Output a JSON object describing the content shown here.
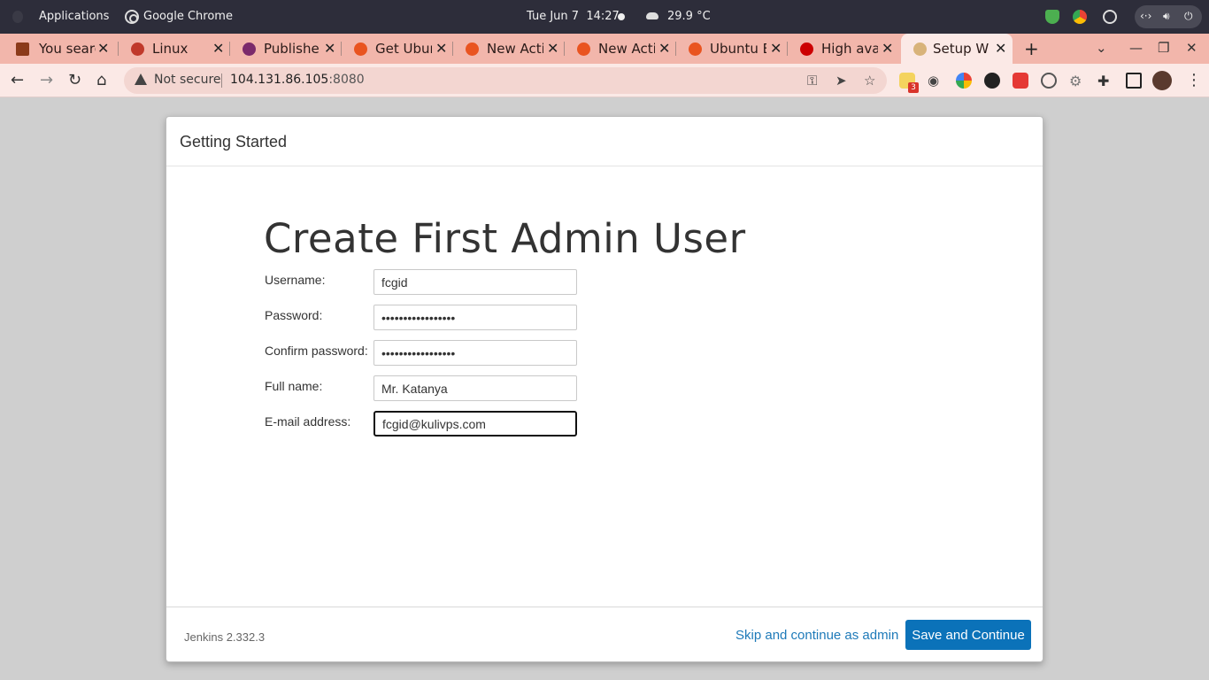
{
  "system_bar": {
    "applications": "Applications",
    "active_app": "Google Chrome",
    "date": "Tue Jun 7",
    "time": "14:27",
    "temperature": "29.9 °C"
  },
  "tabs": [
    {
      "title": "You searc",
      "favicon_color": "#8b3a1a"
    },
    {
      "title": "Linux",
      "favicon_color": "#c0392b"
    },
    {
      "title": "Publisher",
      "favicon_color": "#7b2a6b"
    },
    {
      "title": "Get Ubun",
      "favicon_color": "#e95420"
    },
    {
      "title": "New Acti",
      "favicon_color": "#e95420"
    },
    {
      "title": "New Acti",
      "favicon_color": "#e95420"
    },
    {
      "title": "Ubuntu E",
      "favicon_color": "#e95420"
    },
    {
      "title": "High ava",
      "favicon_color": "#cc0000"
    },
    {
      "title": "Setup Wi",
      "favicon_color": "#d8b37a",
      "active": true
    }
  ],
  "address_bar": {
    "security_label": "Not secure",
    "host": "104.131.86.105",
    "port": ":8080"
  },
  "extensions": {
    "badge_count": "3"
  },
  "dialog": {
    "header_title": "Getting Started",
    "heading": "Create First Admin User",
    "fields": {
      "username": {
        "label": "Username:",
        "value": "fcgid"
      },
      "password": {
        "label": "Password:",
        "value": "•••••••••••••••••"
      },
      "confirm_password": {
        "label": "Confirm password:",
        "value": "•••••••••••••••••"
      },
      "full_name": {
        "label": "Full name:",
        "value": "Mr. Katanya"
      },
      "email": {
        "label": "E-mail address:",
        "value": "fcgid@kulivps.com"
      }
    },
    "footer": {
      "version": "Jenkins 2.332.3",
      "skip_link": "Skip and continue as admin",
      "save_button": "Save and Continue"
    }
  },
  "colors": {
    "tab_strip": "#f2b6ab",
    "toolbar": "#fbe9e6",
    "jenkins_primary": "#0b72b9",
    "link": "#1e7ab9"
  }
}
